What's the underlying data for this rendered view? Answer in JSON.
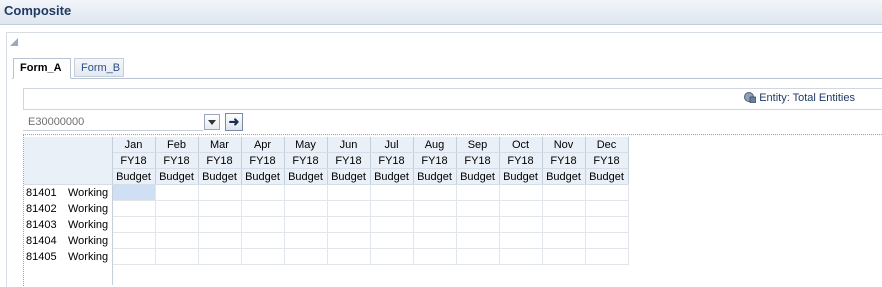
{
  "window": {
    "title": "Composite"
  },
  "tabs": [
    {
      "label": "Form_A",
      "active": true
    },
    {
      "label": "Form_B",
      "active": false
    }
  ],
  "pov": {
    "entity_label": "Entity: Total Entities"
  },
  "selector": {
    "value": "E30000000",
    "go_icon": "arrow-right-icon",
    "dropdown_icon": "chevron-down-icon"
  },
  "grid": {
    "months": [
      "Jan",
      "Feb",
      "Mar",
      "Apr",
      "May",
      "Jun",
      "Jul",
      "Aug",
      "Sep",
      "Oct",
      "Nov",
      "Dec"
    ],
    "year": "FY18",
    "scenario": "Budget",
    "rows": [
      {
        "account": "81401",
        "version": "Working"
      },
      {
        "account": "81402",
        "version": "Working"
      },
      {
        "account": "81403",
        "version": "Working"
      },
      {
        "account": "81404",
        "version": "Working"
      },
      {
        "account": "81405",
        "version": "Working"
      }
    ]
  },
  "colors": {
    "header_bg": "#eaf0f7",
    "selected_cell": "#cfe0f4",
    "title_text": "#1f3a63"
  }
}
